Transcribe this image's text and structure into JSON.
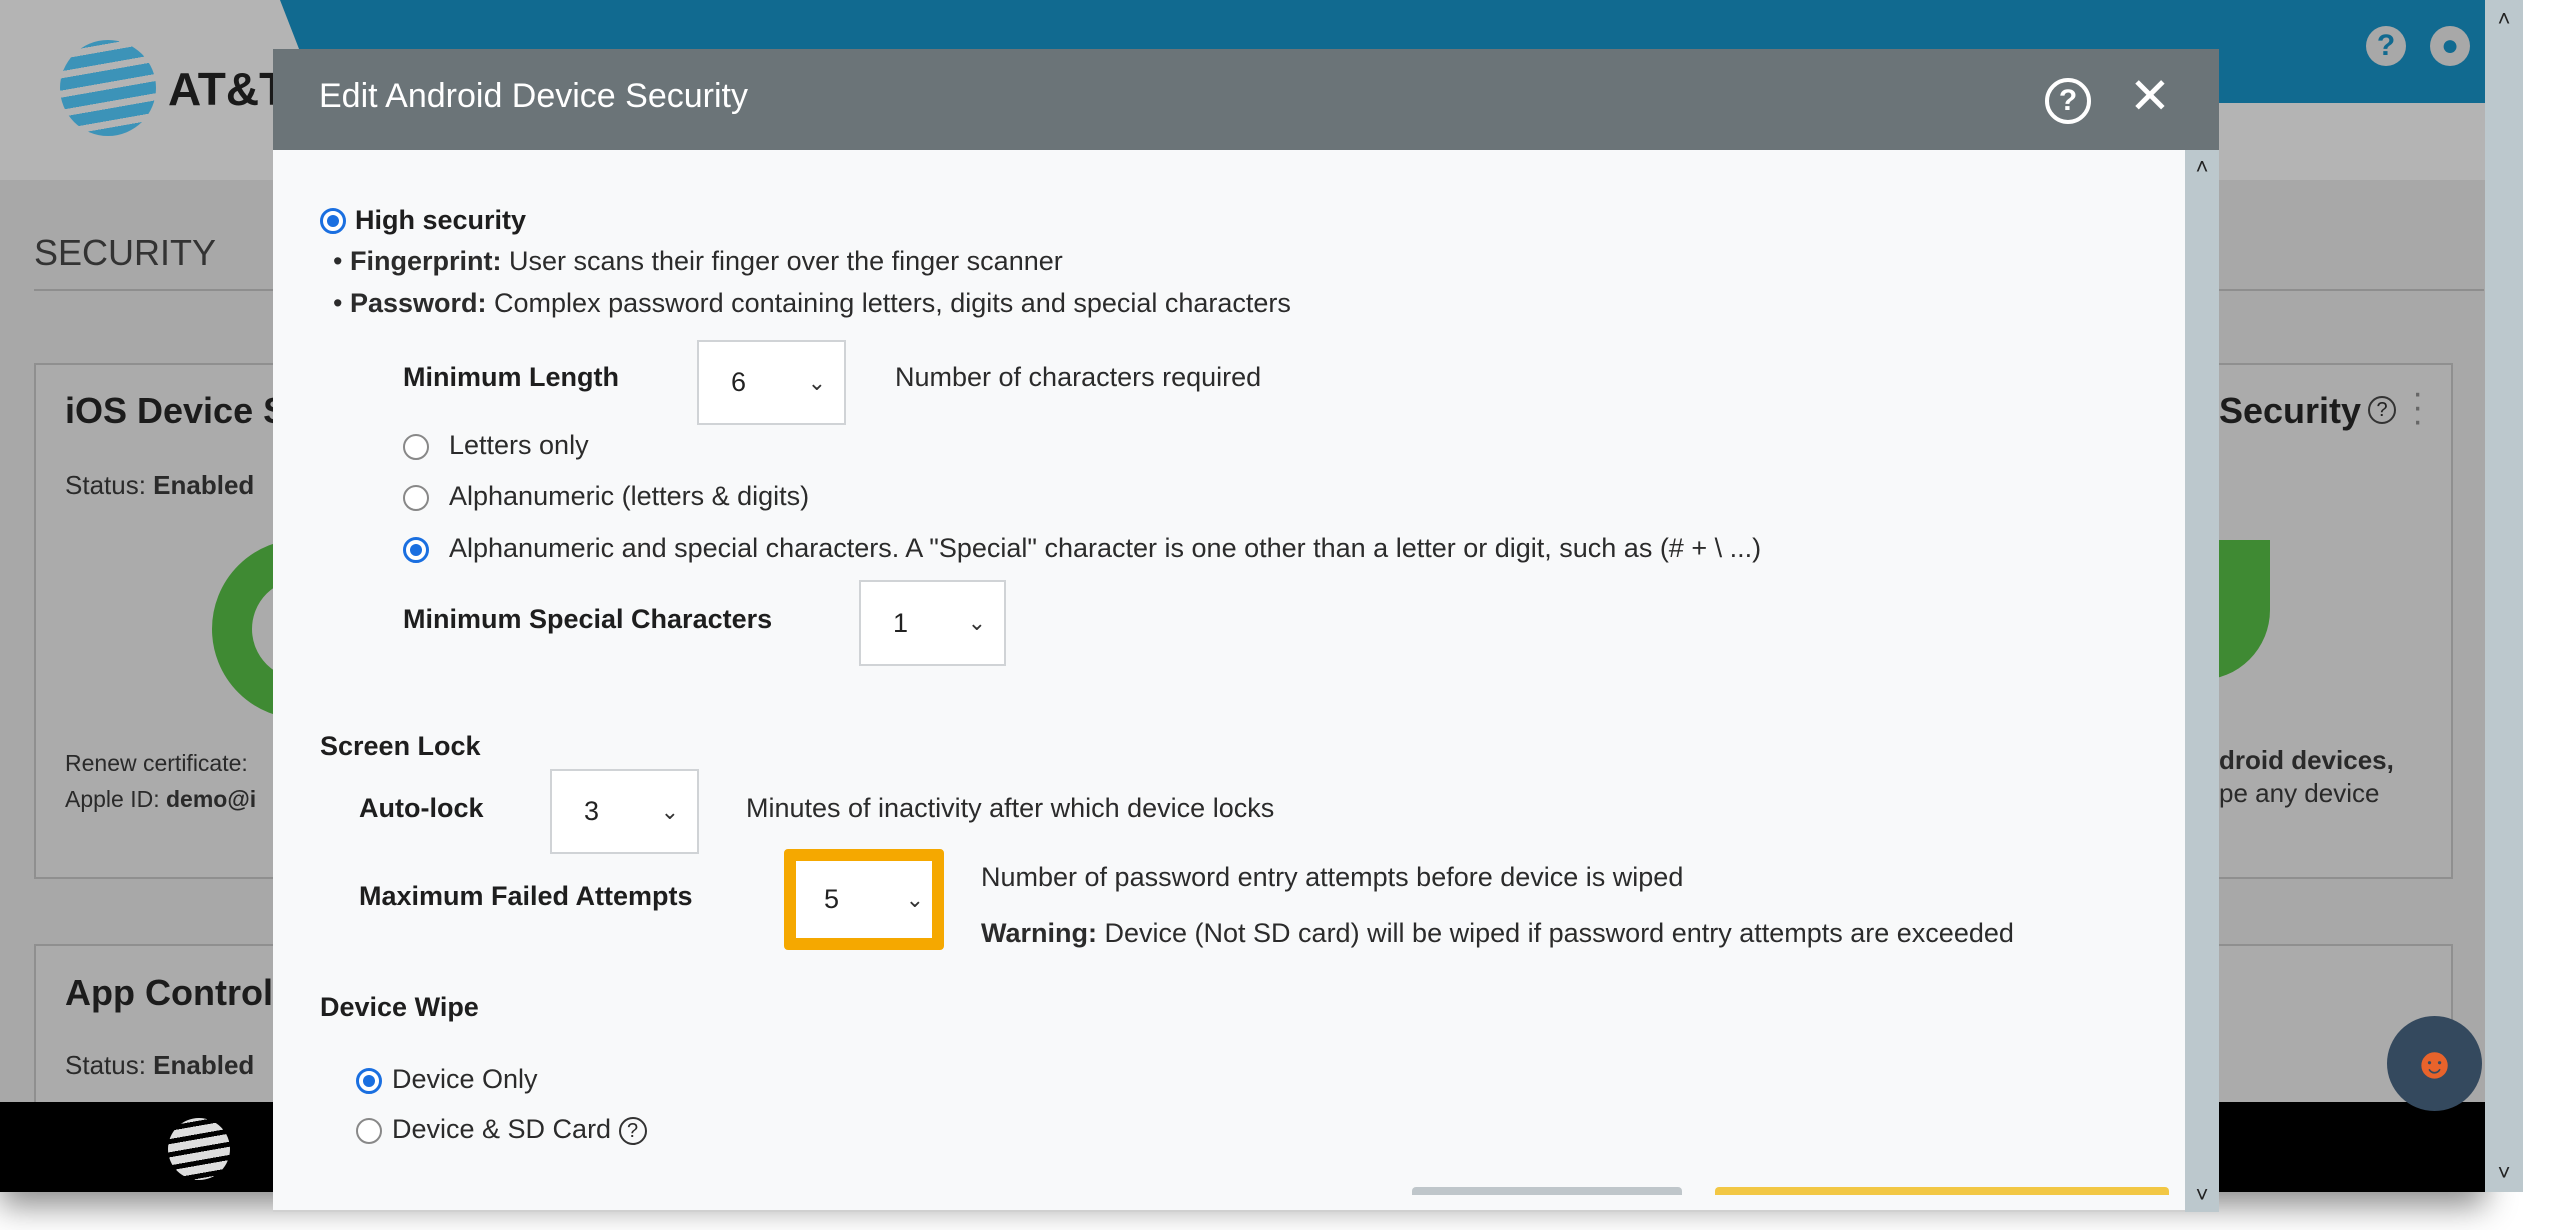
{
  "background": {
    "brand": "AT&T",
    "section_title": "SECURITY",
    "ios_card": {
      "title": "iOS Device S",
      "status_label": "Status:",
      "status_value": "Enabled",
      "renew_label": "Renew certificate:",
      "apple_id_label": "Apple ID:",
      "apple_id_value": "demo@i"
    },
    "android_card": {
      "title": "Security",
      "line1": "droid devices,",
      "line2": "pe any device"
    },
    "app_card": {
      "title": "App Control",
      "status_label": "Status:",
      "status_value": "Enabled"
    },
    "colors": {
      "header": "#116a90",
      "accent_green": "#3f8a33"
    }
  },
  "modal": {
    "title": "Edit Android Device Security",
    "high_security": {
      "label": "High security",
      "selected": true
    },
    "fingerprint": {
      "label": "Fingerprint:",
      "text": "User scans their finger over the finger scanner"
    },
    "password": {
      "label": "Password:",
      "text": "Complex password containing letters, digits and special characters"
    },
    "min_length": {
      "label": "Minimum Length",
      "value": "6",
      "hint": "Number of characters required"
    },
    "char_options": [
      {
        "label": "Letters only",
        "selected": false
      },
      {
        "label": "Alphanumeric (letters & digits)",
        "selected": false
      },
      {
        "label": "Alphanumeric and special characters. A \"Special\" character is one other than a letter or digit, such as  (# + \\ ...)",
        "selected": true
      }
    ],
    "min_special": {
      "label": "Minimum Special Characters",
      "value": "1"
    },
    "screen_lock": {
      "heading": "Screen Lock",
      "autolock_label": "Auto-lock",
      "autolock_value": "3",
      "autolock_hint": "Minutes of inactivity after which device locks",
      "max_failed_label": "Maximum Failed Attempts",
      "max_failed_value": "5",
      "max_failed_hint": "Number of password entry attempts before device is wiped",
      "warning_label": "Warning:",
      "warning_text": "Device (Not SD card) will be wiped if password entry attempts are exceeded"
    },
    "device_wipe": {
      "heading": "Device Wipe",
      "options": [
        {
          "label": "Device Only",
          "selected": true
        },
        {
          "label": "Device & SD Card",
          "selected": false
        }
      ]
    },
    "highlight_color": "#f5a800"
  }
}
